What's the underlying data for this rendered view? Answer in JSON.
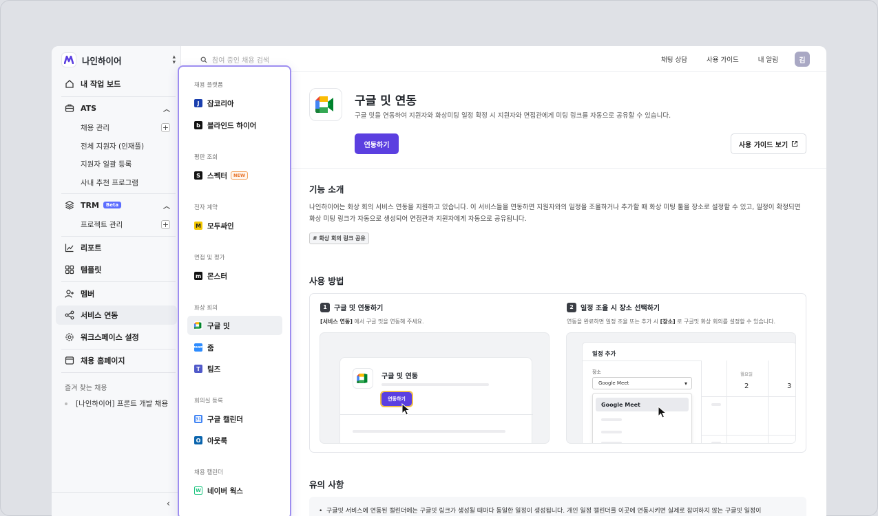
{
  "workspace": {
    "name": "나인하이어"
  },
  "sidebar": {
    "my_board": "내 작업 보드",
    "ats": {
      "label": "ATS",
      "items": [
        "채용 관리",
        "전체 지원자 (인재풀)",
        "지원자 일괄 등록",
        "사내 추천 프로그램"
      ]
    },
    "trm": {
      "label": "TRM",
      "badge": "Beta",
      "items": [
        "프로젝트 관리"
      ]
    },
    "report": "리포트",
    "template": "템플릿",
    "member": "멤버",
    "service": "서비스 연동",
    "workspace_settings": "워크스페이스 설정",
    "homepage": "채용 홈페이지",
    "favorites_title": "즐겨 찾는 채용",
    "favorites": [
      "[나인하이어] 프론트 개발 채용"
    ]
  },
  "topbar": {
    "search_placeholder": "참여 중인 채용 검색",
    "chat": "채팅 상담",
    "guide": "사용 가이드",
    "alerts": "내 알림",
    "avatar": "김"
  },
  "panel": {
    "groups": [
      {
        "title": "채용 플랫폼",
        "items": [
          {
            "label": "잡코리아",
            "icon": "jobkorea-icon"
          },
          {
            "label": "블라인드 하이어",
            "icon": "blind-icon"
          }
        ]
      },
      {
        "title": "평판 조회",
        "items": [
          {
            "label": "스펙터",
            "icon": "specter-icon",
            "badge": "NEW"
          }
        ]
      },
      {
        "title": "전자 계약",
        "items": [
          {
            "label": "모두싸인",
            "icon": "modusign-icon"
          }
        ]
      },
      {
        "title": "면접 및 평가",
        "items": [
          {
            "label": "몬스터",
            "icon": "monster-icon"
          }
        ]
      },
      {
        "title": "화상 회의",
        "items": [
          {
            "label": "구글 밋",
            "icon": "google-meet-icon"
          },
          {
            "label": "줌",
            "icon": "zoom-icon"
          },
          {
            "label": "팀즈",
            "icon": "teams-icon"
          }
        ]
      },
      {
        "title": "회의실 등록",
        "items": [
          {
            "label": "구글 캘린더",
            "icon": "google-calendar-icon"
          },
          {
            "label": "아웃룩",
            "icon": "outlook-icon"
          }
        ]
      },
      {
        "title": "채용 캘린더",
        "items": [
          {
            "label": "네이버 웍스",
            "icon": "naver-works-icon"
          }
        ]
      }
    ]
  },
  "main": {
    "title": "구글 밋 연동",
    "description": "구글 밋을 연동하여 지원자와 화상미팅 일정 확정 시 지원자와 면접관에게 미팅 링크를 자동으로 공유할 수 있습니다.",
    "connect_button": "연동하기",
    "guide_button": "사용 가이드 보기",
    "features_title": "기능 소개",
    "features_text": "나인하이어는 화상 회의 서비스 연동을 지원하고 있습니다. 이 서비스들을 연동하면 지원자와의 일정을 조율하거나 추가할 때 화상 미팅 툴을 장소로 설정할 수 있고, 일정이 확정되면 화상 미팅 링크가 자동으로 생성되어 면접관과 지원자에게 자동으로 공유됩니다.",
    "tag": "# 화상 회의 링크 공유",
    "howto_title": "사용 방법",
    "steps": [
      {
        "num": "1",
        "title": "구글 밋 연동하기",
        "desc_bold": "[서비스 연동]",
        "desc": " 에서 구글 밋을 연동해 주세요."
      },
      {
        "num": "2",
        "title": "일정 조율 시 장소 선택하기",
        "desc_pre": "연동을 완료하면 일정 조율 또는 추가 시 ",
        "desc_bold": "[장소]",
        "desc": " 로 구글밋 화상 회의를 설정할 수 있습니다."
      }
    ],
    "mock1": {
      "title": "구글 밋 연동",
      "button": "연동하기"
    },
    "mock2": {
      "title": "일정 추가",
      "label": "장소",
      "select": "Google Meet",
      "option": "Google Meet",
      "day": "월요일",
      "num1": "2",
      "num2": "3"
    },
    "notes_title": "유의 사항",
    "note": "구글밋 서비스에 연동된 캘린더에는 구글밋 링크가 생성될 때마다 동일한 일정이 생성됩니다. 개인 일정 캘린더를 이곳에 연동시키면 실제로 참여하지 않는 구글밋 일정이"
  },
  "colors": {
    "accent": "#5b3fe0",
    "panel_border": "#9d8df0"
  }
}
